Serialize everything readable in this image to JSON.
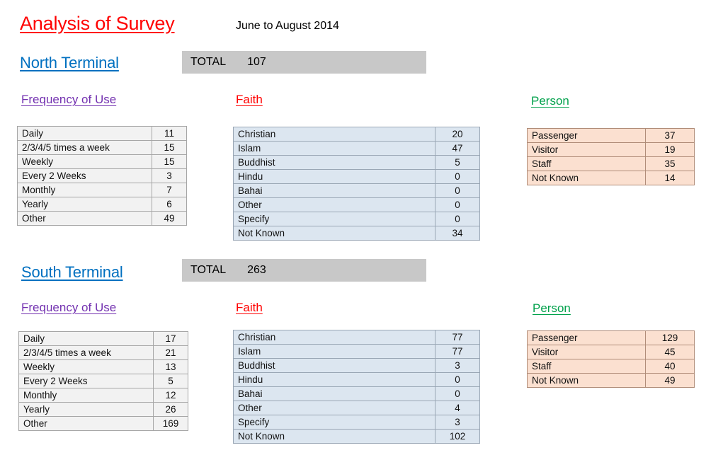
{
  "document": {
    "title": "Analysis of Survey",
    "subtitle": "June to August 2014",
    "colors": {
      "title": "#ff0000",
      "terminal": "#0070c0",
      "frequency_heading": "#7331b0",
      "faith_heading": "#ff0000",
      "person_heading": "#00a14b",
      "total_banner": "#c8c8c8",
      "frequency_table_fill": "#f2f2f2",
      "faith_table_fill": "#dce6f0",
      "person_table_fill": "#fbe0d0"
    }
  },
  "sections": [
    {
      "terminal": "North Terminal",
      "total_label": "TOTAL",
      "total_value": "107",
      "frequency": {
        "heading": "Frequency of Use",
        "rows": [
          {
            "label": "Daily",
            "value": "11"
          },
          {
            "label": "2/3/4/5 times a week",
            "value": "15"
          },
          {
            "label": "Weekly",
            "value": "15"
          },
          {
            "label": "Every 2 Weeks",
            "value": "3"
          },
          {
            "label": "Monthly",
            "value": "7"
          },
          {
            "label": "Yearly",
            "value": "6"
          },
          {
            "label": "Other",
            "value": "49"
          }
        ]
      },
      "faith": {
        "heading": "Faith",
        "rows": [
          {
            "label": "Christian",
            "value": "20"
          },
          {
            "label": "Islam",
            "value": "47"
          },
          {
            "label": "Buddhist",
            "value": "5"
          },
          {
            "label": "Hindu",
            "value": "0"
          },
          {
            "label": "Bahai",
            "value": "0"
          },
          {
            "label": "Other",
            "value": "0"
          },
          {
            "label": "Specify",
            "value": "0"
          },
          {
            "label": "Not Known",
            "value": "34"
          }
        ]
      },
      "person": {
        "heading": "Person",
        "rows": [
          {
            "label": "Passenger",
            "value": "37"
          },
          {
            "label": "Visitor",
            "value": "19"
          },
          {
            "label": "Staff",
            "value": "35"
          },
          {
            "label": "Not Known",
            "value": "14"
          }
        ]
      }
    },
    {
      "terminal": "South Terminal",
      "total_label": "TOTAL",
      "total_value": "263",
      "frequency": {
        "heading": "Frequency of Use",
        "rows": [
          {
            "label": "Daily",
            "value": "17"
          },
          {
            "label": "2/3/4/5 times a week",
            "value": "21"
          },
          {
            "label": "Weekly",
            "value": "13"
          },
          {
            "label": "Every 2 Weeks",
            "value": "5"
          },
          {
            "label": "Monthly",
            "value": "12"
          },
          {
            "label": "Yearly",
            "value": "26"
          },
          {
            "label": "Other",
            "value": "169"
          }
        ]
      },
      "faith": {
        "heading": "Faith",
        "rows": [
          {
            "label": "Christian",
            "value": "77"
          },
          {
            "label": "Islam",
            "value": "77"
          },
          {
            "label": "Buddhist",
            "value": "3"
          },
          {
            "label": "Hindu",
            "value": "0"
          },
          {
            "label": "Bahai",
            "value": "0"
          },
          {
            "label": "Other",
            "value": "4"
          },
          {
            "label": "Specify",
            "value": "3"
          },
          {
            "label": "Not Known",
            "value": "102"
          }
        ]
      },
      "person": {
        "heading": "Person",
        "rows": [
          {
            "label": "Passenger",
            "value": "129"
          },
          {
            "label": "Visitor",
            "value": "45"
          },
          {
            "label": "Staff",
            "value": "40"
          },
          {
            "label": "Not Known",
            "value": "49"
          }
        ]
      }
    }
  ]
}
